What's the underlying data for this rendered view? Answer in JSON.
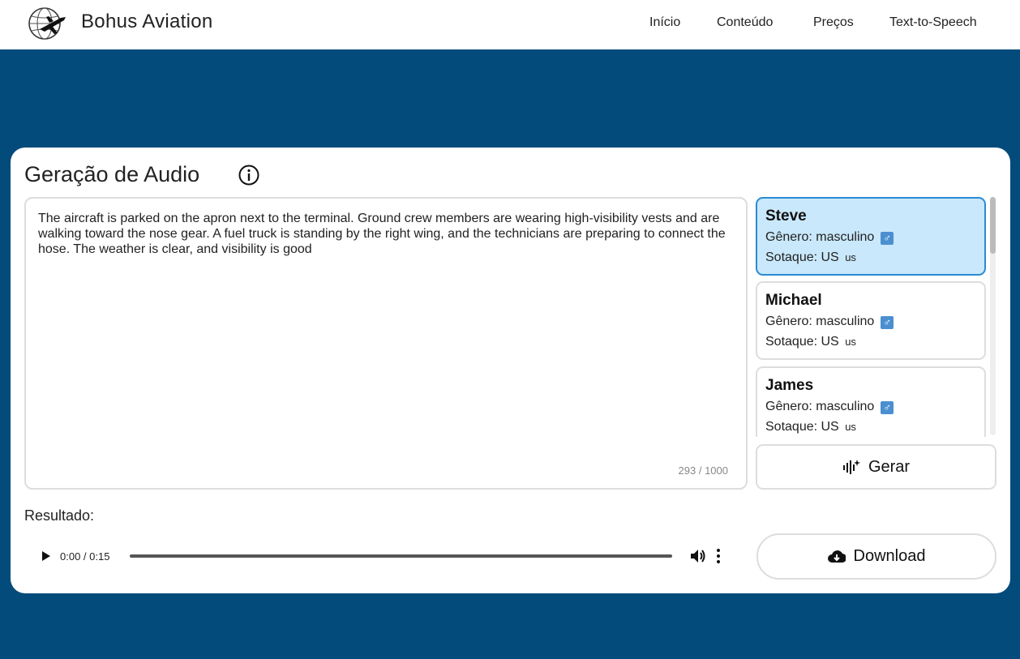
{
  "header": {
    "brand": "Bohus Aviation",
    "nav": [
      "Início",
      "Conteúdo",
      "Preços",
      "Text-to-Speech"
    ]
  },
  "main": {
    "title": "Geração de Audio",
    "text_value": "The aircraft is parked on the apron next to the terminal. Ground crew members are wearing high-visibility vests and are walking toward the nose gear. A fuel truck is standing by the right wing, and the technicians are preparing to connect the hose. The weather is clear, and visibility is good",
    "counter": "293 / 1000",
    "voices": [
      {
        "name": "Steve",
        "gender": "Gênero: masculino",
        "accent": "Sotaque: US",
        "flag": "us",
        "selected": true
      },
      {
        "name": "Michael",
        "gender": "Gênero: masculino",
        "accent": "Sotaque: US",
        "flag": "us",
        "selected": false
      },
      {
        "name": "James",
        "gender": "Gênero: masculino",
        "accent": "Sotaque: US",
        "flag": "us",
        "selected": false
      }
    ],
    "gerar_label": "Gerar",
    "result_label": "Resultado:",
    "player": {
      "time": "0:00 / 0:15"
    },
    "download_label": "Download"
  },
  "colors": {
    "page_bg": "#034b7a",
    "selected_voice_bg": "#c9e8fb",
    "selected_voice_border": "#2a8bd2"
  }
}
